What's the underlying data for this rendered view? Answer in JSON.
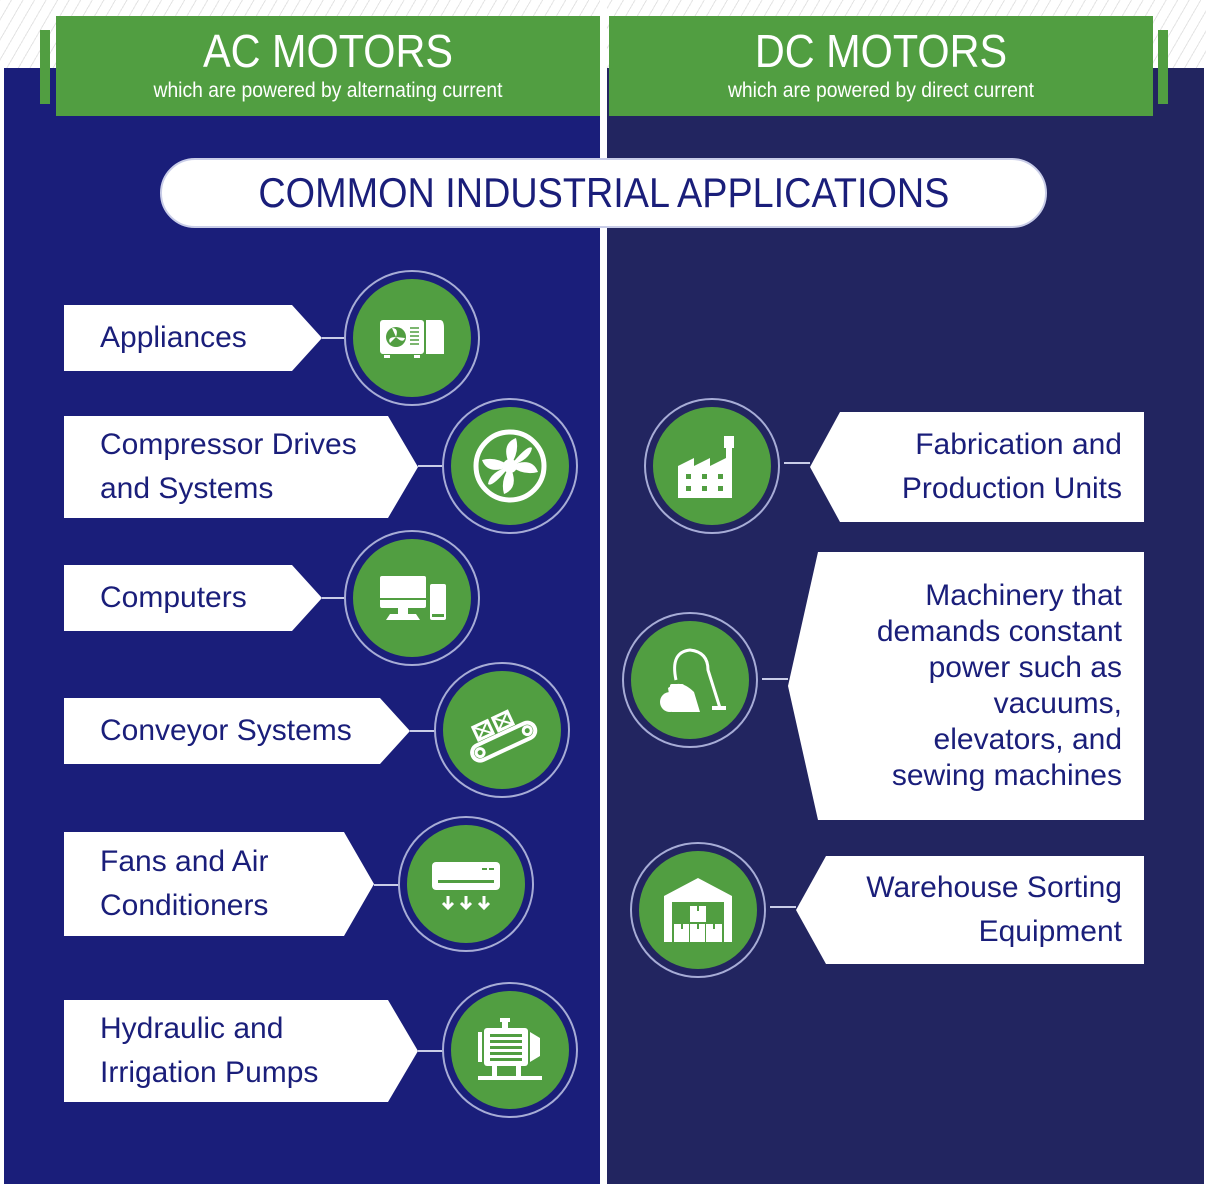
{
  "header": {
    "ac": {
      "title": "AC MOTORS",
      "subtitle": "which are powered by alternating current"
    },
    "dc": {
      "title": "DC MOTORS",
      "subtitle": "which are powered by direct current"
    },
    "section_title": "COMMON INDUSTRIAL APPLICATIONS"
  },
  "colors": {
    "green": "#519e41",
    "ac_panel": "#1a1e7a",
    "dc_panel": "#222560",
    "text": "#1a1e7a"
  },
  "ac_applications": [
    {
      "label": "Appliances",
      "icon": "appliance-icon"
    },
    {
      "label": "Compressor Drives\nand Systems",
      "icon": "compressor-fan-icon"
    },
    {
      "label": "Computers",
      "icon": "computer-icon"
    },
    {
      "label": "Conveyor Systems",
      "icon": "conveyor-icon"
    },
    {
      "label": "Fans and Air\nConditioners",
      "icon": "air-conditioner-icon"
    },
    {
      "label": "Hydraulic and\nIrrigation Pumps",
      "icon": "pump-motor-icon"
    }
  ],
  "dc_applications": [
    {
      "label": "Fabrication and\nProduction Units",
      "icon": "factory-icon"
    },
    {
      "label": "Machinery that\ndemands constant\npower such as\nvacuums,\nelevators, and\nsewing machines",
      "icon": "vacuum-icon"
    },
    {
      "label": "Warehouse Sorting\nEquipment",
      "icon": "warehouse-icon"
    }
  ]
}
